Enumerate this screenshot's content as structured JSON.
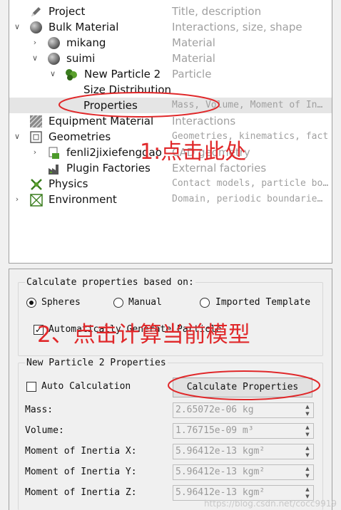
{
  "tree": {
    "rows": [
      {
        "label": "Project",
        "desc": "Title, description"
      },
      {
        "label": "Bulk Material",
        "desc": "Interactions, size, shape"
      },
      {
        "label": "mikang",
        "desc": "Material"
      },
      {
        "label": "suimi",
        "desc": "Material"
      },
      {
        "label": "New Particle 2",
        "desc": "Particle"
      },
      {
        "label": "Size Distribution",
        "desc": ""
      },
      {
        "label": "Properties",
        "desc": "Mass, Volume, Moment of In…"
      },
      {
        "label": "Equipment Material",
        "desc": "Interactions"
      },
      {
        "label": "Geometries",
        "desc": "Geometries, kinematics, fact"
      },
      {
        "label": "fenli2jixiefengdao",
        "desc": "CAD geometry"
      },
      {
        "label": "Plugin Factories",
        "desc": "External factories"
      },
      {
        "label": "Physics",
        "desc": "Contact models, particle bo…"
      },
      {
        "label": "Environment",
        "desc": "Domain, periodic boundarie…"
      }
    ]
  },
  "calc": {
    "title": "Calculate properties based on:",
    "radios": [
      {
        "label": "Spheres",
        "checked": true
      },
      {
        "label": "Manual",
        "checked": false
      },
      {
        "label": "Imported Template",
        "checked": false
      }
    ],
    "auto_generate": "Automatically Generate Particle"
  },
  "props": {
    "title": "New Particle 2 Properties",
    "auto_calc": "Auto Calculation",
    "button": "Calculate Properties",
    "fields": [
      {
        "label": "Mass:",
        "value": "2.65072e-06 kg"
      },
      {
        "label": "Volume:",
        "value": "1.76715e-09 m³"
      },
      {
        "label": "Moment of Inertia X:",
        "value": "5.96412e-13 kgm²"
      },
      {
        "label": "Moment of Inertia Y:",
        "value": "5.96412e-13 kgm²"
      },
      {
        "label": "Moment of Inertia Z:",
        "value": "5.96412e-13 kgm²"
      }
    ]
  },
  "annotations": {
    "step1": "1:点击此处",
    "step2": "2、点击计算当前模型"
  },
  "watermark": "https://blog.csdn.net/cocc9919",
  "colors": {
    "annotation": "#e0282a",
    "selection": "#e5e5e5"
  }
}
